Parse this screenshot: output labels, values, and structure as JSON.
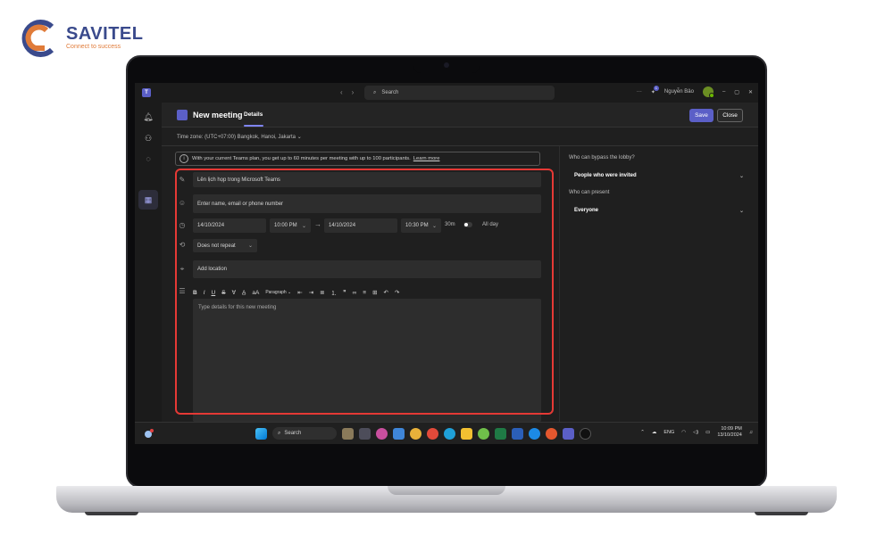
{
  "brand": {
    "name": "SAVITEL",
    "tagline": "Connect to success"
  },
  "teams": {
    "search_placeholder": "Search",
    "user_name": "Nguyễn Bảo",
    "notif_count": "1",
    "more_label": "···"
  },
  "meeting": {
    "title": "New meeting",
    "tab": "Details",
    "save_label": "Save",
    "close_label": "Close",
    "timezone": "Time zone: (UTC+07:00) Bangkok, Hanoi, Jakarta",
    "info_text": "With your current Teams plan, you get up to 60 minutes per meeting with up to 100 participants.",
    "learn_more": "Learn more",
    "meeting_title_value": "Lên lịch họp trong Microsoft Teams",
    "attendees_placeholder": "Enter name, email or phone number",
    "start_date": "14/10/2024",
    "start_time": "10:00 PM",
    "end_date": "14/10/2024",
    "end_time": "10:30 PM",
    "duration": "30m",
    "all_day_label": "All day",
    "repeat_value": "Does not repeat",
    "location_placeholder": "Add location",
    "paragraph_label": "Paragraph",
    "details_placeholder": "Type details for this new meeting"
  },
  "lobby": {
    "bypass_label": "Who can bypass the lobby?",
    "bypass_value": "People who were invited",
    "present_label": "Who can present",
    "present_value": "Everyone"
  },
  "taskbar": {
    "search_label": "Search",
    "language": "ENG",
    "time": "10:09 PM",
    "date": "13/10/2024"
  },
  "colors": {
    "accent": "#5b5fc7",
    "highlight_box": "#e53935",
    "brand_blue": "#3a4a8c",
    "brand_orange": "#e07b39"
  }
}
